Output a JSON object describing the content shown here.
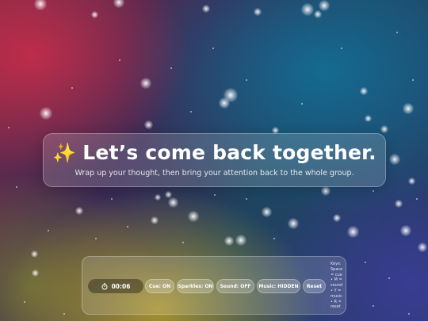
{
  "cue": {
    "emoji": "✨",
    "title": "Let’s come back together.",
    "subtitle": "Wrap up your thought, then bring your attention back to the whole group."
  },
  "controls": {
    "timer_icon": "stopwatch-icon",
    "timer": "00:06",
    "cue_toggle": "Cue: ON",
    "sparkles_toggle": "Sparkles: ON",
    "sound_toggle": "Sound: OFF",
    "music_toggle": "Music: HIDDEN",
    "reset": "Reset"
  },
  "keys_help": {
    "lines": [
      "Keys:",
      "Space",
      "= cue",
      "• M =",
      "sound",
      "• Y =",
      "music",
      "• R =",
      "reset"
    ]
  }
}
